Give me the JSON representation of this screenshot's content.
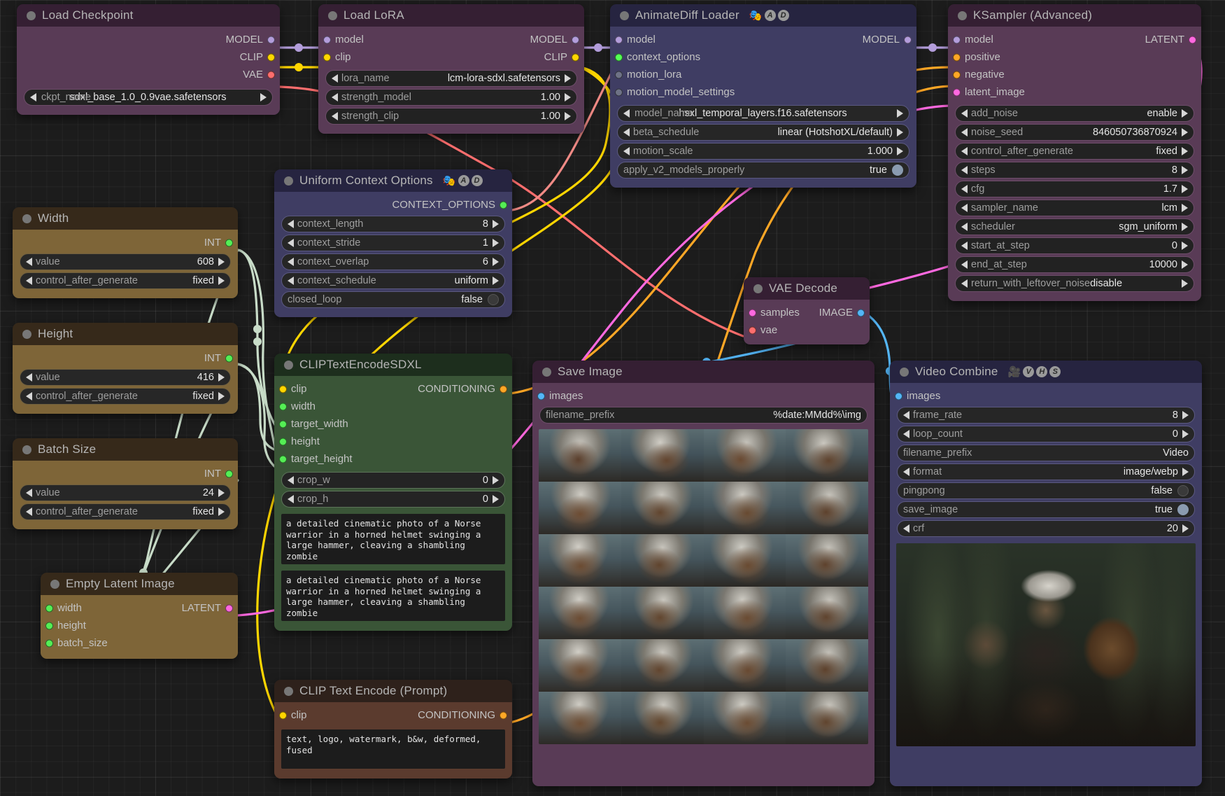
{
  "app": "ComfyUI node graph",
  "nodes": {
    "load_checkpoint": {
      "title": "Load Checkpoint",
      "outputs": [
        "MODEL",
        "CLIP",
        "VAE"
      ],
      "widgets": [
        {
          "name": "ckpt_name",
          "value": "sdxl_base_1.0_0.9vae.safetensors",
          "type": "combo"
        }
      ]
    },
    "load_lora": {
      "title": "Load LoRA",
      "inputs": [
        "model",
        "clip"
      ],
      "outputs": [
        "MODEL",
        "CLIP"
      ],
      "widgets": [
        {
          "name": "lora_name",
          "value": "lcm-lora-sdxl.safetensors",
          "type": "combo"
        },
        {
          "name": "strength_model",
          "value": "1.00",
          "type": "number"
        },
        {
          "name": "strength_clip",
          "value": "1.00",
          "type": "number"
        }
      ]
    },
    "animatediff_loader": {
      "title": "AnimateDiff Loader",
      "badges": [
        "🎭",
        "A",
        "D"
      ],
      "inputs": [
        "model",
        "context_options",
        "motion_lora",
        "motion_model_settings"
      ],
      "outputs": [
        "MODEL"
      ],
      "widgets": [
        {
          "name": "model_name",
          "value": "hsxl_temporal_layers.f16.safetensors",
          "type": "combo"
        },
        {
          "name": "beta_schedule",
          "value": "linear (HotshotXL/default)",
          "type": "combo"
        },
        {
          "name": "motion_scale",
          "value": "1.000",
          "type": "number"
        },
        {
          "name": "apply_v2_models_properly",
          "value": "true",
          "type": "toggle"
        }
      ]
    },
    "ksampler_advanced": {
      "title": "KSampler (Advanced)",
      "inputs": [
        "model",
        "positive",
        "negative",
        "latent_image"
      ],
      "outputs": [
        "LATENT"
      ],
      "widgets": [
        {
          "name": "add_noise",
          "value": "enable",
          "type": "combo"
        },
        {
          "name": "noise_seed",
          "value": "846050736870924",
          "type": "number"
        },
        {
          "name": "control_after_generate",
          "value": "fixed",
          "type": "combo"
        },
        {
          "name": "steps",
          "value": "8",
          "type": "number"
        },
        {
          "name": "cfg",
          "value": "1.7",
          "type": "number"
        },
        {
          "name": "sampler_name",
          "value": "lcm",
          "type": "combo"
        },
        {
          "name": "scheduler",
          "value": "sgm_uniform",
          "type": "combo"
        },
        {
          "name": "start_at_step",
          "value": "0",
          "type": "number"
        },
        {
          "name": "end_at_step",
          "value": "10000",
          "type": "number"
        },
        {
          "name": "return_with_leftover_noise",
          "value": "disable",
          "type": "combo"
        }
      ]
    },
    "width_node": {
      "title": "Width",
      "outputs": [
        "INT"
      ],
      "widgets": [
        {
          "name": "value",
          "value": "608",
          "type": "number"
        },
        {
          "name": "control_after_generate",
          "value": "fixed",
          "type": "combo"
        }
      ]
    },
    "height_node": {
      "title": "Height",
      "outputs": [
        "INT"
      ],
      "widgets": [
        {
          "name": "value",
          "value": "416",
          "type": "number"
        },
        {
          "name": "control_after_generate",
          "value": "fixed",
          "type": "combo"
        }
      ]
    },
    "batch_size_node": {
      "title": "Batch Size",
      "outputs": [
        "INT"
      ],
      "widgets": [
        {
          "name": "value",
          "value": "24",
          "type": "number"
        },
        {
          "name": "control_after_generate",
          "value": "fixed",
          "type": "combo"
        }
      ]
    },
    "empty_latent_image": {
      "title": "Empty Latent Image",
      "inputs": [
        "width",
        "height",
        "batch_size"
      ],
      "outputs": [
        "LATENT"
      ],
      "widgets": []
    },
    "uniform_context_options": {
      "title": "Uniform Context Options",
      "badges": [
        "🎭",
        "A",
        "D"
      ],
      "outputs": [
        "CONTEXT_OPTIONS"
      ],
      "widgets": [
        {
          "name": "context_length",
          "value": "8",
          "type": "number"
        },
        {
          "name": "context_stride",
          "value": "1",
          "type": "number"
        },
        {
          "name": "context_overlap",
          "value": "6",
          "type": "number"
        },
        {
          "name": "context_schedule",
          "value": "uniform",
          "type": "combo"
        },
        {
          "name": "closed_loop",
          "value": "false",
          "type": "toggle"
        }
      ]
    },
    "clip_text_encode_sdxl": {
      "title": "CLIPTextEncodeSDXL",
      "inputs": [
        "clip",
        "width",
        "target_width",
        "height",
        "target_height"
      ],
      "outputs": [
        "CONDITIONING"
      ],
      "widgets": [
        {
          "name": "crop_w",
          "value": "0",
          "type": "number"
        },
        {
          "name": "crop_h",
          "value": "0",
          "type": "number"
        }
      ],
      "text_g": "a detailed cinematic photo of a Norse warrior in a horned helmet swinging a large hammer, cleaving a shambling zombie",
      "text_l": "a detailed cinematic photo of a Norse warrior in a horned helmet swinging a large hammer, cleaving a shambling zombie"
    },
    "clip_text_encode_prompt": {
      "title": "CLIP Text Encode (Prompt)",
      "inputs": [
        "clip"
      ],
      "outputs": [
        "CONDITIONING"
      ],
      "text": "text, logo, watermark, b&w, deformed, fused"
    },
    "vae_decode": {
      "title": "VAE Decode",
      "inputs": [
        "samples",
        "vae"
      ],
      "outputs": [
        "IMAGE"
      ],
      "widgets": []
    },
    "save_image": {
      "title": "Save Image",
      "inputs": [
        "images"
      ],
      "widgets": [
        {
          "name": "filename_prefix",
          "value": "%date:MMdd%\\img",
          "type": "text"
        }
      ]
    },
    "video_combine": {
      "title": "Video Combine",
      "badges": [
        "🎥",
        "V",
        "H",
        "S"
      ],
      "inputs": [
        "images"
      ],
      "widgets": [
        {
          "name": "frame_rate",
          "value": "8",
          "type": "number"
        },
        {
          "name": "loop_count",
          "value": "0",
          "type": "number"
        },
        {
          "name": "filename_prefix",
          "value": "Video",
          "type": "text"
        },
        {
          "name": "format",
          "value": "image/webp",
          "type": "combo"
        },
        {
          "name": "pingpong",
          "value": "false",
          "type": "toggle"
        },
        {
          "name": "save_image",
          "value": "true",
          "type": "toggle"
        },
        {
          "name": "crf",
          "value": "20",
          "type": "number"
        }
      ]
    }
  },
  "colors": {
    "model_link": "#b39ddb",
    "clip_link": "#ffd600",
    "vae_link": "#ff6e6e",
    "conditioning_link": "#ffa726",
    "latent_link": "#ff69e0",
    "image_link": "#54b6f7",
    "int_link": "#c8dcc8",
    "context_link": "#55ff55"
  }
}
